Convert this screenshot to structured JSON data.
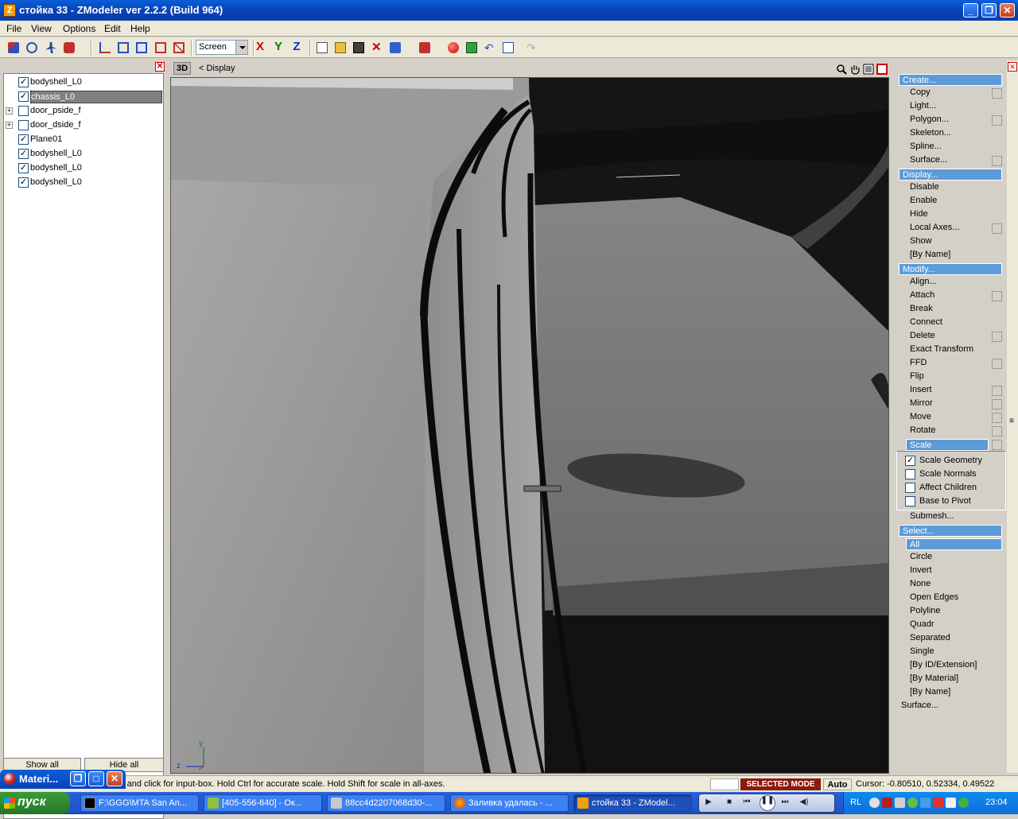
{
  "window": {
    "title": "стойка 33 - ZModeler ver 2.2.2 (Build 964)",
    "app_icon": "Z",
    "minimize": "_",
    "maximize": "❐",
    "close": "✕"
  },
  "menu": {
    "file": "File",
    "view": "View",
    "options": "Options",
    "edit": "Edit",
    "help": "Help"
  },
  "toolbar": {
    "view_mode": "Screen",
    "axis_x": "X",
    "axis_y": "Y",
    "axis_z": "Z"
  },
  "tree": {
    "items": [
      {
        "label": "bodyshell_L0",
        "checked": "✓",
        "expandable": ""
      },
      {
        "label": "chassis_L0",
        "checked": "✓",
        "expandable": ""
      },
      {
        "label": "door_pside_f",
        "checked": "",
        "expandable": "+"
      },
      {
        "label": "door_dside_f",
        "checked": "",
        "expandable": "+"
      },
      {
        "label": "Plane01",
        "checked": "✓",
        "expandable": ""
      },
      {
        "label": "bodyshell_L0",
        "checked": "✓",
        "expandable": ""
      },
      {
        "label": "bodyshell_L0",
        "checked": "✓",
        "expandable": ""
      },
      {
        "label": "bodyshell_L0",
        "checked": "✓",
        "expandable": ""
      }
    ],
    "show_all": "Show all",
    "hide_all": "Hide all",
    "close": "✕"
  },
  "viewport": {
    "mode": "3D",
    "breadcrumb": "<  Display",
    "axis_y": "y",
    "axis_z": "z"
  },
  "commands": {
    "create": {
      "header": "Create...",
      "items": [
        "Copy",
        "Light...",
        "Polygon...",
        "Skeleton...",
        "Spline...",
        "Surface..."
      ]
    },
    "display": {
      "header": "Display...",
      "items": [
        "Disable",
        "Enable",
        "Hide",
        "Local Axes...",
        "Show",
        "[By Name]"
      ]
    },
    "modify": {
      "header": "Modify...",
      "items": [
        "Align...",
        "Attach",
        "Break",
        "Connect",
        "Delete",
        "Exact Transform",
        "FFD",
        "Flip",
        "Insert",
        "Mirror",
        "Move",
        "Rotate"
      ]
    },
    "scale": {
      "header": "Scale",
      "options": [
        "Scale Geometry",
        "Scale Normals",
        "Affect Children",
        "Base to Pivot"
      ],
      "checked": [
        "✓",
        "",
        "",
        ""
      ]
    },
    "submesh": "Submesh...",
    "select": {
      "header": "Select...",
      "active": "All",
      "items": [
        "Circle",
        "Invert",
        "None",
        "Open Edges",
        "Polyline",
        "Quadr",
        "Separated",
        "Single",
        "[By ID/Extension]",
        "[By Material]",
        "[By Name]"
      ]
    },
    "surface": "Surface..."
  },
  "status": {
    "hint": "el and click for input-box. Hold Ctrl for accurate scale. Hold Shift for scale in all-axes.",
    "selected_mode": "SELECTED MODE",
    "auto": "Auto",
    "cursor": "Cursor: -0.80510, 0.52334, 0.49522"
  },
  "material_window": {
    "title": "Materi...",
    "restore": "❐",
    "maximize": "□",
    "close": "✕"
  },
  "taskbar": {
    "start": "пуск",
    "tasks": [
      "F:\\GGG\\MTA San An...",
      "[405-556-640] - Ок...",
      "88cc4d2207068d30-...",
      "Заливка удалась - ...",
      "стойка 33 - ZModel..."
    ],
    "lang": "RL",
    "clock": "23:04"
  },
  "colors": {
    "title_blue": "#0842b8",
    "accent_header": "#5b9bd8",
    "selected_mode_bg": "#8b1a10",
    "start_green": "#2f8b2f"
  }
}
